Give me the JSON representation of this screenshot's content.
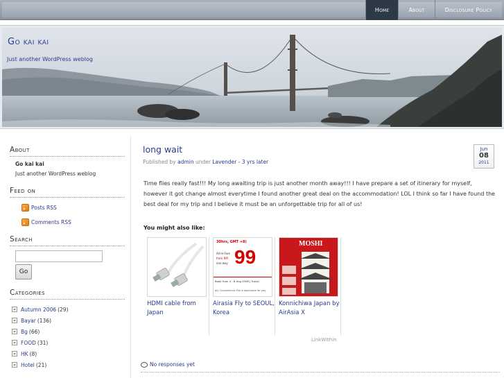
{
  "nav": {
    "items": [
      {
        "label": "Home",
        "active": true
      },
      {
        "label": "About",
        "active": false
      },
      {
        "label": "Disclosure Policy",
        "active": false
      }
    ]
  },
  "site": {
    "title": "Go kai kai",
    "description": "Just another WordPress weblog"
  },
  "sidebar": {
    "about": {
      "title": "About",
      "name": "Go kai kai",
      "text": "Just another WordPress weblog"
    },
    "feeds": {
      "title": "Feed on",
      "posts": "Posts RSS",
      "comments": "Comments RSS"
    },
    "search": {
      "title": "Search",
      "button": "Go"
    },
    "categories": {
      "title": "Categories",
      "items": [
        {
          "name": "Autumn 2006",
          "count": "(29)"
        },
        {
          "name": "Bayar",
          "count": "(136)"
        },
        {
          "name": "Bg",
          "count": "(66)"
        },
        {
          "name": "FOOD",
          "count": "(31)"
        },
        {
          "name": "HK",
          "count": "(8)"
        },
        {
          "name": "Hotel",
          "count": "(21)"
        }
      ]
    }
  },
  "post": {
    "title": "long wait",
    "meta_published": "Published by",
    "author": "admin",
    "meta_under": "under",
    "category": "Lavender - 3 yrs later",
    "date": {
      "month": "Jun",
      "day": "08",
      "year": "2011"
    },
    "body": "Time flies really fast!!! My long awaiting trip is just another month away!!! I have prepare a set of itinerary for myself, however it got change almost everytime I found another great deal on the accommodation! LOL I think so far I have found the best deal for my trip and I believe it must be an unforgettable trip for all of us!",
    "also_like": "You might also like:",
    "related": [
      {
        "title": "HDMI cable from Japan"
      },
      {
        "title": "Airasia Fly to SEOUL, Korea"
      },
      {
        "title": "Konnichiwa Japan by AirAsia X"
      }
    ],
    "linkwithin": "LinkWithin",
    "responses": "No responses yet"
  },
  "thumb_text": {
    "airasia_top": "30hrs, GMT +8)",
    "airasia_fare": "All-In-Fare",
    "airasia_fly": "from RM",
    "airasia_way": "one way",
    "airasia_price": "99",
    "airasia_book": "Book from 4 - 8 Aug 2008 | Travel",
    "airasia_note": "ply. Convenience Fee is applicable for pay",
    "mosh": "MOSHI"
  }
}
